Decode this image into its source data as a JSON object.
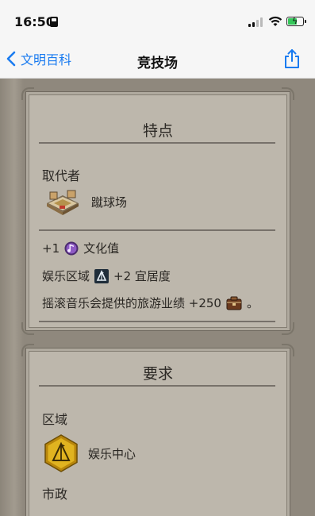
{
  "status": {
    "time": "16:50"
  },
  "nav": {
    "back_label": "文明百科",
    "title": "竞技场"
  },
  "features": {
    "title": "特点",
    "replaces_heading": "取代者",
    "replaces_item": {
      "label": "蹴球场",
      "icon": "stadium-icon"
    },
    "lines": [
      {
        "prefix": "+1",
        "icon": "culture-icon",
        "suffix": "文化值"
      },
      {
        "prefix": "娱乐区域",
        "icon": "entertainment-district-icon",
        "suffix": "+2 宜居度"
      },
      {
        "prefix": "摇滚音乐会提供的旅游业绩 +250",
        "icon": "tourism-icon",
        "suffix": "。"
      }
    ]
  },
  "requirements": {
    "title": "要求",
    "district_heading": "区域",
    "district_item": {
      "label": "娱乐中心",
      "icon": "entertainment-complex-icon"
    },
    "civic_heading": "市政"
  },
  "colors": {
    "link": "#1a7bf0",
    "panel": "#bdb7ac",
    "battery": "#34c759"
  }
}
